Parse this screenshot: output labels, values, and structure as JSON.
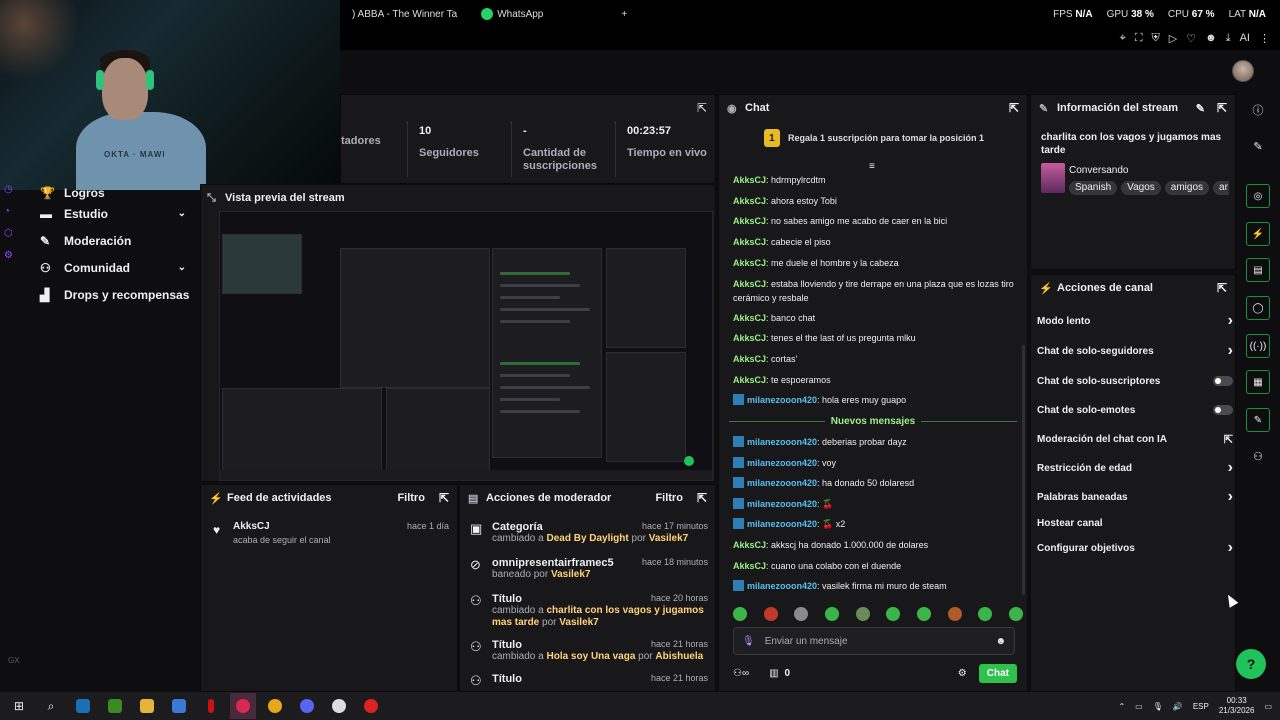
{
  "browser": {
    "tabs": [
      {
        "label": ") ABBA - The Winner Ta"
      },
      {
        "label": "WhatsApp"
      }
    ],
    "new_tab": "+",
    "stats": {
      "fps_label": "FPS",
      "fps_value": "N/A",
      "gpu_label": "GPU",
      "gpu_value": "38 %",
      "cpu_label": "CPU",
      "cpu_value": "67 %",
      "lat_label": "LAT",
      "lat_value": "N/A"
    },
    "ai_label": "AI"
  },
  "sidebar": {
    "items": [
      {
        "label": "Logros",
        "icon": "trophy-icon"
      },
      {
        "label": "Estudio",
        "icon": "studio-icon",
        "expandable": true
      },
      {
        "label": "Moderación",
        "icon": "wrench-icon"
      },
      {
        "label": "Comunidad",
        "icon": "community-icon",
        "expandable": true
      },
      {
        "label": "Drops y recompensas",
        "icon": "drops-icon"
      }
    ],
    "footer": "GX"
  },
  "stats_panel": {
    "cells": [
      {
        "value": "",
        "label": "tadores"
      },
      {
        "value": "10",
        "label": "Seguidores"
      },
      {
        "value": "-",
        "label": "Cantidad de suscripciones"
      },
      {
        "value": "00:23:57",
        "label": "Tiempo en vivo"
      }
    ]
  },
  "preview": {
    "title": "Vista previa del stream"
  },
  "feed": {
    "title": "Feed de actividades",
    "filter": "Filtro",
    "items": [
      {
        "user": "AkksCJ",
        "action": "acaba de seguir el canal",
        "time": "hace 1 día"
      }
    ]
  },
  "mod_actions": {
    "title": "Acciones de moderador",
    "filter": "Filtro",
    "items": [
      {
        "title": "Categoría",
        "time": "hace 17 minutos",
        "pre": "cambiado a ",
        "target": "Dead By Daylight",
        "by": " por ",
        "mod": "Vasilek7"
      },
      {
        "title": "omnipresentairframec5",
        "time": "hace 18 minutos",
        "pre": "baneado ",
        "target": "",
        "by": "por ",
        "mod": "Vasilek7"
      },
      {
        "title": "Título",
        "time": "hace 20 horas",
        "pre": "cambiado a ",
        "target": "charlita con los vagos y jugamos mas tarde",
        "by": " por ",
        "mod": "Vasilek7"
      },
      {
        "title": "Título",
        "time": "hace 21 horas",
        "pre": "cambiado a ",
        "target": "Hola soy Una vaga",
        "by": " por ",
        "mod": "Abishuela"
      },
      {
        "title": "Título",
        "time": "hace 21 horas",
        "pre": "",
        "target": "",
        "by": "",
        "mod": ""
      }
    ]
  },
  "chat": {
    "title": "Chat",
    "banner_rank": "1",
    "banner": "Regala 1 suscripción para tomar la posición 1",
    "messages_before": [
      {
        "user": "AkksCJ",
        "text": "hdrmpylrcdtm",
        "style": "green"
      },
      {
        "user": "AkksCJ",
        "text": "ahora estoy Tobi",
        "style": "green"
      },
      {
        "user": "AkksCJ",
        "text": "no sabes amigo me acabo de caer en la bici",
        "style": "green"
      },
      {
        "user": "AkksCJ",
        "text": "cabecie el piso",
        "style": "green"
      },
      {
        "user": "AkksCJ",
        "text": "me duele el hombre y la cabeza",
        "style": "green"
      },
      {
        "user": "AkksCJ",
        "text": "estaba lloviendo y tire derrape en una plaza que es lozas tiro cerámico y resbale",
        "style": "green"
      },
      {
        "user": "AkksCJ",
        "text": "banco chat",
        "style": "green"
      },
      {
        "user": "AkksCJ",
        "text": "tenes el the last of us pregunta mlku",
        "style": "green"
      },
      {
        "user": "AkksCJ",
        "text": "cortas'",
        "style": "green"
      },
      {
        "user": "AkksCJ",
        "text": "te espoeramos",
        "style": "green"
      },
      {
        "user": "milanezooon420",
        "text": "hola eres muy guapo",
        "style": "blue"
      }
    ],
    "new_messages": "Nuevos mensajes",
    "messages_after": [
      {
        "user": "milanezooon420",
        "text": "deberias probar dayz",
        "style": "blue"
      },
      {
        "user": "milanezooon420",
        "text": "voy",
        "style": "blue"
      },
      {
        "user": "milanezooon420",
        "text": "ha donado 50 dolaresd",
        "style": "blue"
      },
      {
        "user": "milanezooon420",
        "text": "🍒",
        "style": "blue"
      },
      {
        "user": "milanezooon420",
        "text": "🍒 x2",
        "style": "blue"
      },
      {
        "user": "AkksCJ",
        "text": "akkscj ha donado 1.000.000 de dolares",
        "style": "green"
      },
      {
        "user": "AkksCJ",
        "text": "cuano una colabo con el duende",
        "style": "green"
      },
      {
        "user": "milanezooon420",
        "text": "vasilek firma mi muro de steam",
        "style": "blue"
      }
    ],
    "input_placeholder": "Enviar un mensaje",
    "points": "0",
    "send_label": "Chat"
  },
  "stream_info": {
    "title": "Información del stream",
    "stream_title": "charlita con los vagos y jugamos mas tarde",
    "category": "Conversando",
    "tags": [
      "Spanish",
      "Vagos",
      "amigos",
      "ar"
    ]
  },
  "channel_actions": {
    "title": "Acciones de canal",
    "items": [
      {
        "label": "Modo lento",
        "control": "chevron"
      },
      {
        "label": "Chat de solo-seguidores",
        "control": "chevron"
      },
      {
        "label": "Chat de solo-suscriptores",
        "control": "toggle"
      },
      {
        "label": "Chat de solo-emotes",
        "control": "toggle"
      },
      {
        "label": "Moderación del chat con IA",
        "control": "external"
      },
      {
        "label": "Restricción de edad",
        "control": "chevron"
      },
      {
        "label": "Palabras baneadas",
        "control": "chevron"
      },
      {
        "label": "Hostear canal",
        "control": "none"
      },
      {
        "label": "Configurar objetivos",
        "control": "chevron"
      }
    ]
  },
  "taskbar": {
    "lang": "ESP",
    "time": "00:33",
    "date": "21/3/2026"
  }
}
